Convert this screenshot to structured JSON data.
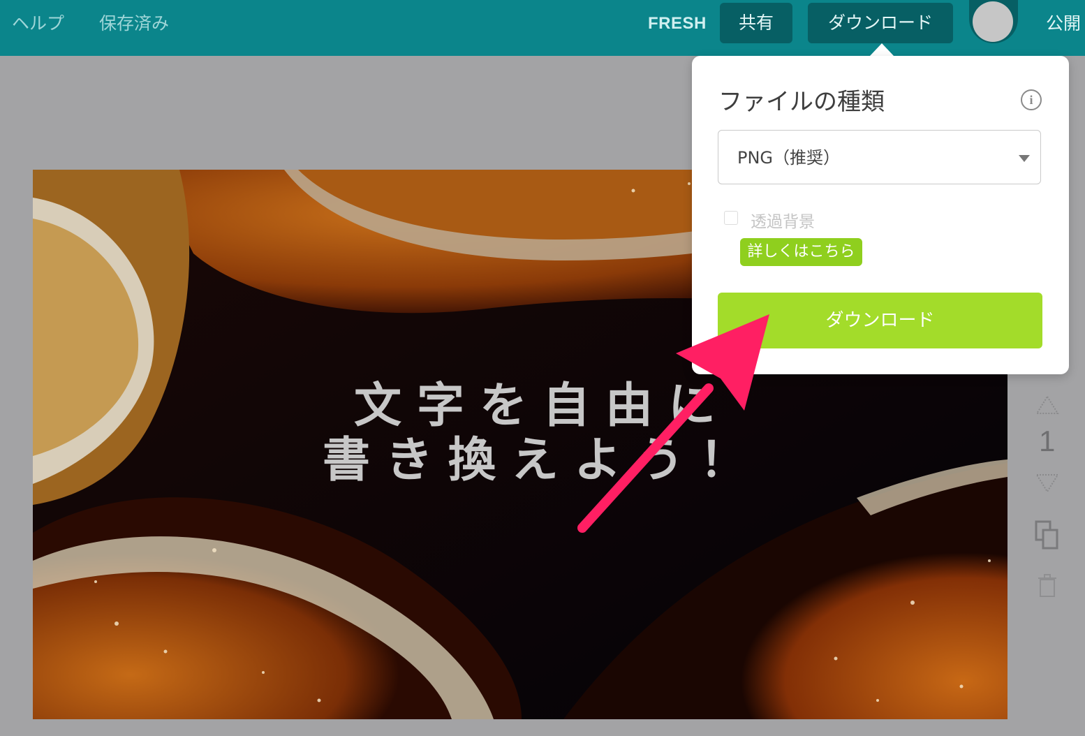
{
  "topbar": {
    "help": "ヘルプ",
    "saved": "保存済み",
    "brand": "FRESH",
    "share": "共有",
    "download": "ダウンロード",
    "publish": "公開"
  },
  "canvas": {
    "text_line1": "文字を自由に",
    "text_line2": "書き換えよう！"
  },
  "sidebar": {
    "page_number": "1"
  },
  "download_panel": {
    "title": "ファイルの種類",
    "file_type_selected": "PNG（推奨）",
    "transparent_bg_label": "透過背景",
    "transparent_bg_checked": false,
    "learn_more": "詳しくはこちら",
    "download_button": "ダウンロード"
  },
  "colors": {
    "topbar": "#0b858b",
    "button_dark": "#075f64",
    "download_green": "#a3dc2a",
    "badge_green": "#8fcf1e",
    "annotation_arrow": "#ff1f63"
  }
}
